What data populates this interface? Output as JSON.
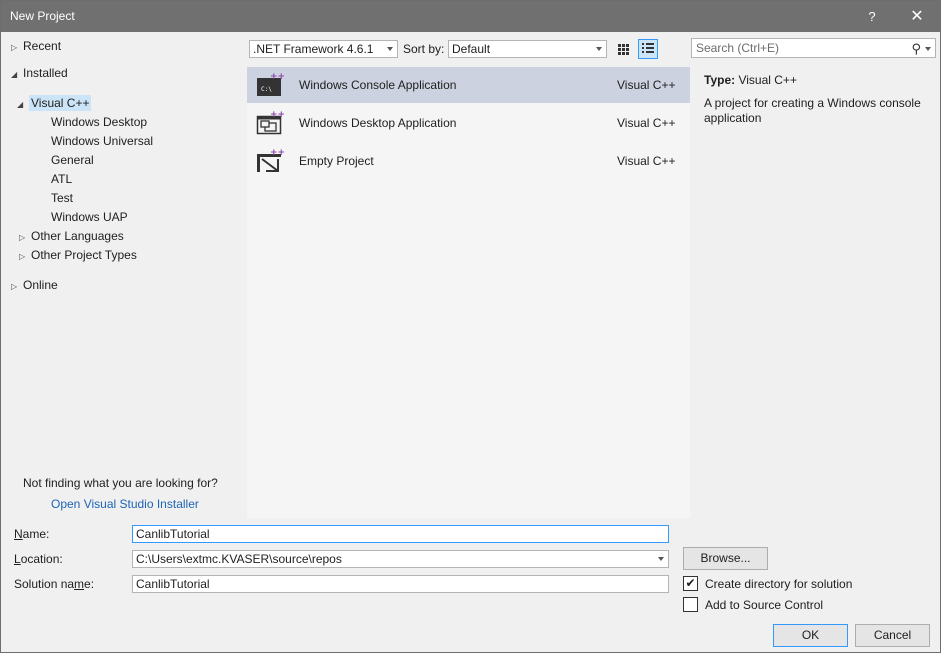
{
  "window": {
    "title": "New Project",
    "help": "?",
    "close": "✕"
  },
  "tree": {
    "recent": "Recent",
    "installed": "Installed",
    "visual_cpp": "Visual C++",
    "children": [
      "Windows Desktop",
      "Windows Universal",
      "General",
      "ATL",
      "Test",
      "Windows UAP"
    ],
    "other_languages": "Other Languages",
    "other_project_types": "Other Project Types",
    "online": "Online",
    "not_finding": "Not finding what you are looking for?",
    "installer_link": "Open Visual Studio Installer"
  },
  "toolbar": {
    "framework": ".NET Framework 4.6.1",
    "sort_label": "Sort by:",
    "sort_value": "Default",
    "search_placeholder": "Search (Ctrl+E)"
  },
  "templates": [
    {
      "name": "Windows Console Application",
      "lang": "Visual C++"
    },
    {
      "name": "Windows Desktop Application",
      "lang": "Visual C++"
    },
    {
      "name": "Empty Project",
      "lang": "Visual C++"
    }
  ],
  "description": {
    "type_label": "Type:",
    "type_value": "Visual C++",
    "text": "A project for creating a Windows console application"
  },
  "form": {
    "name_value": "CanlibTutorial",
    "location_value": "C:\\Users\\extmc.KVASER\\source\\repos",
    "solution_value": "CanlibTutorial",
    "browse": "Browse...",
    "create_dir": "Create directory for solution",
    "create_dir_checked": true,
    "source_control": "Add to Source Control",
    "source_control_checked": false,
    "ok": "OK",
    "cancel": "Cancel"
  }
}
